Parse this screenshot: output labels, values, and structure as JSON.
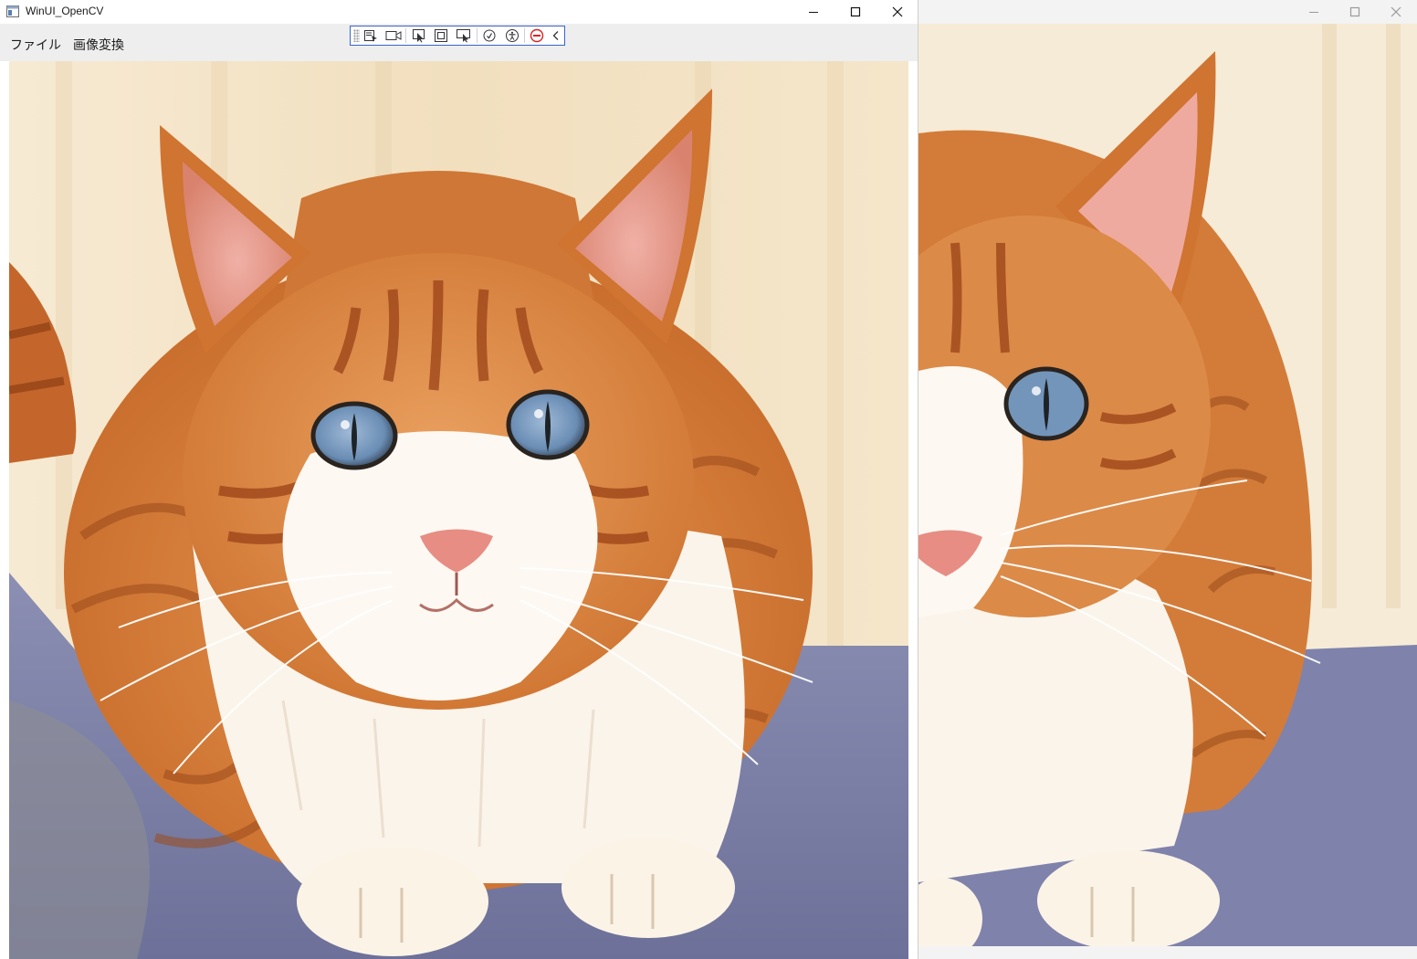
{
  "window_main": {
    "title": "WinUI_OpenCV",
    "menu": [
      {
        "label": "ファイル"
      },
      {
        "label": "画像変換"
      }
    ],
    "caption_buttons": [
      "minimize-icon",
      "maximize-icon",
      "close-icon"
    ],
    "debug_toolbar_icons": [
      "select-element-icon",
      "record-icon",
      "pointer-select-icon",
      "layout-bounds-icon",
      "track-focus-icon",
      "hot-reload-icon",
      "accessibility-icon",
      "stop-icon",
      "collapse-chevron-icon"
    ]
  },
  "window_second": {
    "caption_buttons": [
      "minimize-icon",
      "maximize-icon",
      "close-icon"
    ]
  },
  "images": {
    "original": "orange tabby cat with blue eyes lying on a blue carpet",
    "processed": "enlarged crop of the same cat photo"
  },
  "colors": {
    "fur_orange": "#d9803a",
    "fur_dark": "#b4531f",
    "chest_white": "#fbf4ea",
    "background_wall": "#f4e3c6",
    "carpet": "#7a7fa8",
    "eye_blue": "#6d8fb5"
  }
}
